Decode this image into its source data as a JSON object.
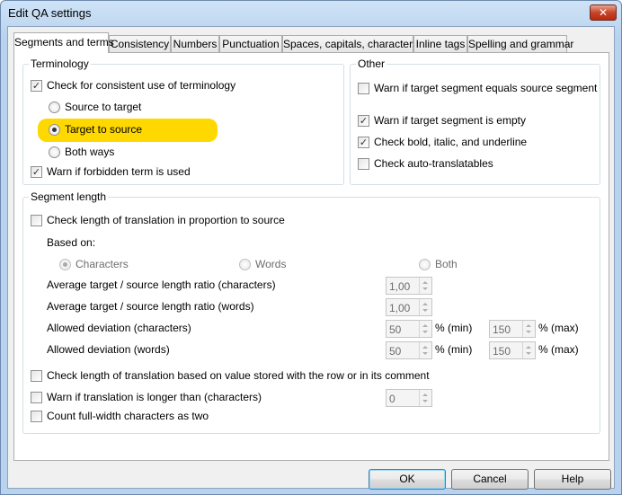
{
  "window": {
    "title": "Edit QA settings",
    "close_glyph": "✕"
  },
  "tabs": [
    {
      "label": "Segments and terms"
    },
    {
      "label": "Consistency"
    },
    {
      "label": "Numbers"
    },
    {
      "label": "Punctuation"
    },
    {
      "label": "Spaces, capitals, characters"
    },
    {
      "label": "Inline tags"
    },
    {
      "label": "Spelling and grammar"
    }
  ],
  "terminology": {
    "label": "Terminology",
    "check_consistent": {
      "label": "Check for consistent use of terminology",
      "checked": true
    },
    "radio_source_to_target": {
      "label": "Source to target",
      "selected": false
    },
    "radio_target_to_source": {
      "label": "Target to source",
      "selected": true
    },
    "radio_both_ways": {
      "label": "Both ways",
      "selected": false
    },
    "warn_forbidden": {
      "label": "Warn if forbidden term is used",
      "checked": true
    },
    "highlight_color": "#ffd800"
  },
  "other": {
    "label": "Other",
    "warn_equals": {
      "label": "Warn if target segment equals source segment",
      "checked": false
    },
    "warn_empty": {
      "label": "Warn if target segment is empty",
      "checked": true
    },
    "check_bold": {
      "label": "Check bold, italic, and underline",
      "checked": true
    },
    "check_autotrans": {
      "label": "Check auto-translatables",
      "checked": false
    }
  },
  "segment_length": {
    "label": "Segment length",
    "check_proportion": {
      "label": "Check length of translation in proportion to source",
      "checked": false
    },
    "based_on_label": "Based on:",
    "radio_characters": "Characters",
    "radio_words": "Words",
    "radio_both": "Both",
    "ratio_chars_label": "Average target / source length ratio (characters)",
    "ratio_chars_value": "1,00",
    "ratio_words_label": "Average target / source length ratio (words)",
    "ratio_words_value": "1,00",
    "dev_chars_label": "Allowed deviation (characters)",
    "dev_chars_min": "50",
    "dev_chars_max": "150",
    "dev_words_label": "Allowed deviation (words)",
    "dev_words_min": "50",
    "dev_words_max": "150",
    "min_unit": "% (min)",
    "max_unit": "% (max)",
    "check_stored": {
      "label": "Check length of translation based on value stored with the row or in its comment",
      "checked": false
    },
    "warn_longer": {
      "label": "Warn if translation is longer than (characters)",
      "checked": false
    },
    "warn_longer_value": "0",
    "count_fullwidth": {
      "label": "Count full-width characters as two",
      "checked": false
    }
  },
  "buttons": {
    "ok": "OK",
    "cancel": "Cancel",
    "help": "Help"
  },
  "check_glyph": "✓"
}
